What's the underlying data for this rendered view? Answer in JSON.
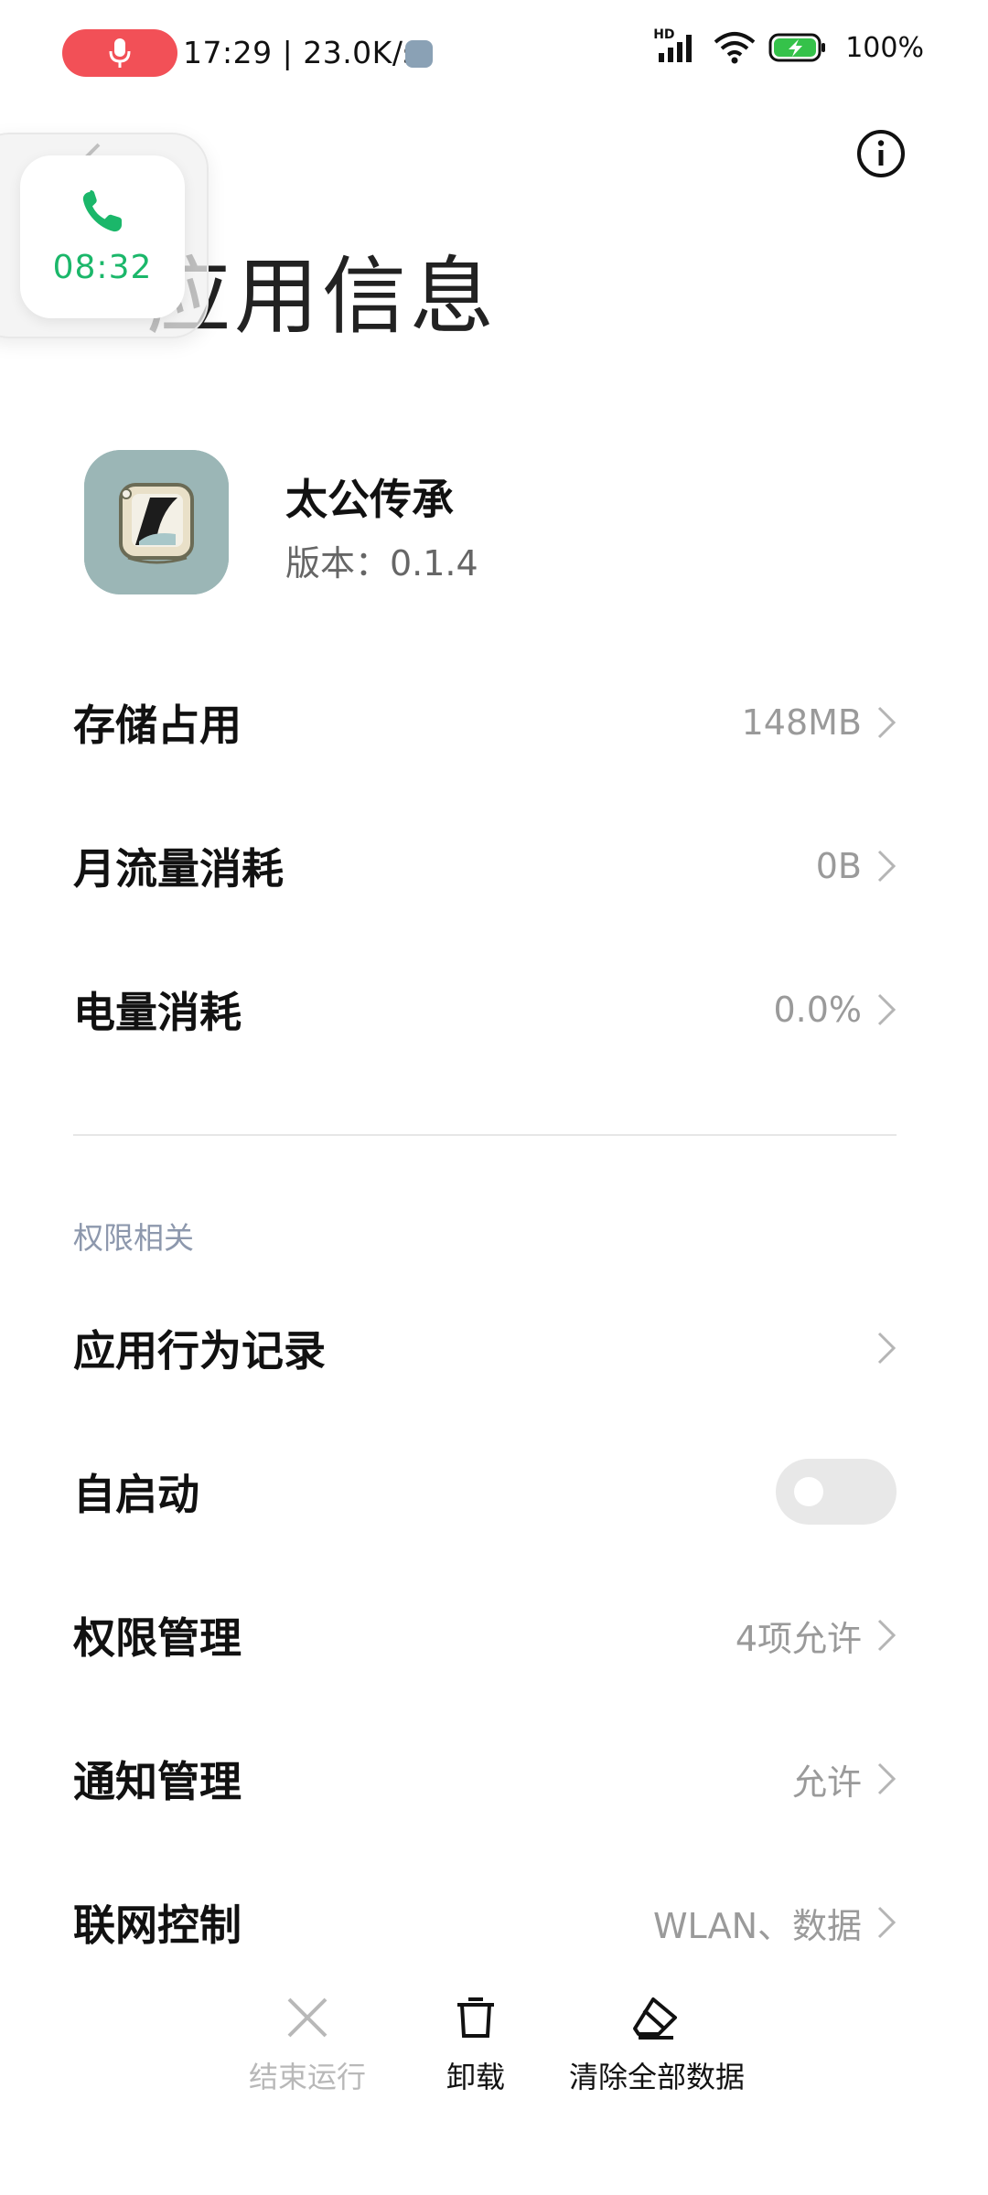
{
  "status_bar": {
    "time_speed": "17:29 | 23.0K/s",
    "network_badge": "HD",
    "battery": "100%",
    "icons": [
      "microphone-icon",
      "signal-icon",
      "wifi-icon",
      "battery-charging-icon"
    ]
  },
  "floating_call": {
    "duration": "08:32",
    "accent_color": "#1bb76a"
  },
  "header": {
    "title": "应用信息",
    "info_icon": "info-icon"
  },
  "app": {
    "name": "太公传承",
    "version": "版本：0.1.4"
  },
  "usage_rows": [
    {
      "label": "存储占用",
      "value": "148MB"
    },
    {
      "label": "月流量消耗",
      "value": "0B"
    },
    {
      "label": "电量消耗",
      "value": "0.0%"
    }
  ],
  "permissions": {
    "section_title": "权限相关",
    "rows": [
      {
        "label": "应用行为记录",
        "value": ""
      },
      {
        "label": "自启动",
        "toggle": false
      },
      {
        "label": "权限管理",
        "value": "4项允许"
      },
      {
        "label": "通知管理",
        "value": "允许"
      },
      {
        "label": "联网控制",
        "value": "WLAN、数据"
      }
    ]
  },
  "bottom_actions": [
    {
      "label": "结束运行",
      "icon": "close-icon",
      "enabled": false
    },
    {
      "label": "卸载",
      "icon": "trash-icon",
      "enabled": true
    },
    {
      "label": "清除全部数据",
      "icon": "eraser-icon",
      "enabled": true
    }
  ],
  "colors": {
    "record_pill": "#f25057",
    "battery_green": "#35c24a",
    "section_title": "#8d98ad",
    "value_gray": "#9a9a9a"
  }
}
